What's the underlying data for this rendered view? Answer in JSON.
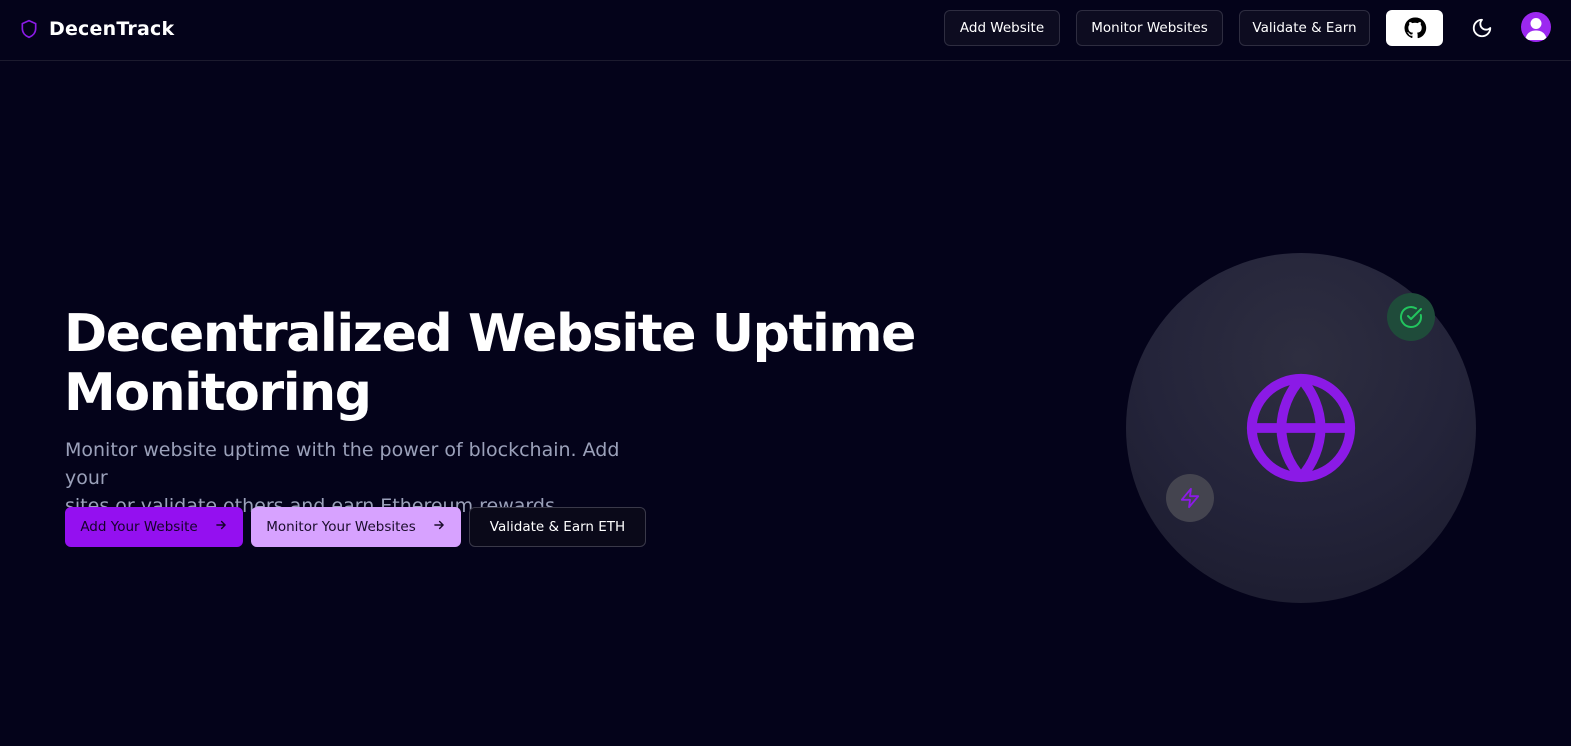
{
  "brand": {
    "name": "DecenTrack",
    "accent_color": "#8b1ae6"
  },
  "nav": {
    "add_website": "Add Website",
    "monitor_websites": "Monitor Websites",
    "validate_earn": "Validate & Earn",
    "github_icon": "github-icon",
    "theme_icon": "moon-icon",
    "avatar_icon": "user-avatar-icon"
  },
  "hero": {
    "title_line1": "Decentralized Website Uptime",
    "title_line2": "Monitoring",
    "subtitle_line1": "Monitor website uptime with the power of blockchain. Add your",
    "subtitle_line2": "sites or validate others and earn Ethereum rewards.",
    "buttons": {
      "add": "Add Your Website",
      "monitor": "Monitor Your Websites",
      "validate": "Validate & Earn ETH"
    },
    "arrow_icon": "arrow-right-icon"
  },
  "illustration": {
    "center_icon": "globe-icon",
    "top_badge_icon": "check-circle-icon",
    "bottom_badge_icon": "zap-icon",
    "colors": {
      "purple": "#8b1ae6",
      "green": "#22c55e",
      "background": "#04031a"
    }
  }
}
